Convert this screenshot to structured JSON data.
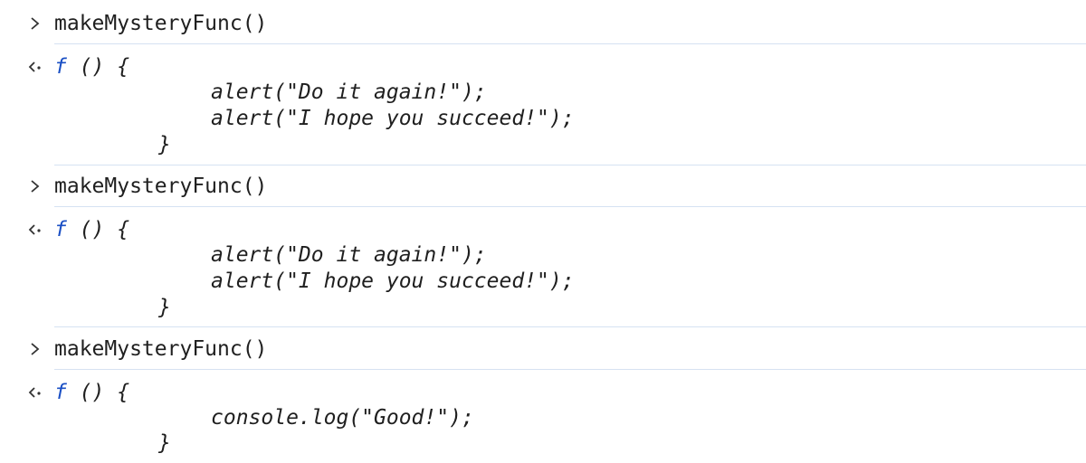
{
  "console": {
    "entries": [
      {
        "input": "makeMysteryFunc()",
        "output_keyword": "f",
        "output_signature": " () {",
        "body": [
          "alert(\"Do it again!\");",
          "alert(\"I hope you succeed!\");"
        ],
        "close": "}"
      },
      {
        "input": "makeMysteryFunc()",
        "output_keyword": "f",
        "output_signature": " () {",
        "body": [
          "alert(\"Do it again!\");",
          "alert(\"I hope you succeed!\");"
        ],
        "close": "}"
      },
      {
        "input": "makeMysteryFunc()",
        "output_keyword": "f",
        "output_signature": " () {",
        "body": [
          "console.log(\"Good!\");"
        ],
        "close": "}"
      }
    ]
  },
  "icons": {
    "input_prompt": "chevron-right-icon",
    "return_value": "return-arrow-icon"
  },
  "colors": {
    "function_keyword": "#1a4fc4",
    "divider": "#d6e2f2",
    "text": "#1f1f1f"
  }
}
